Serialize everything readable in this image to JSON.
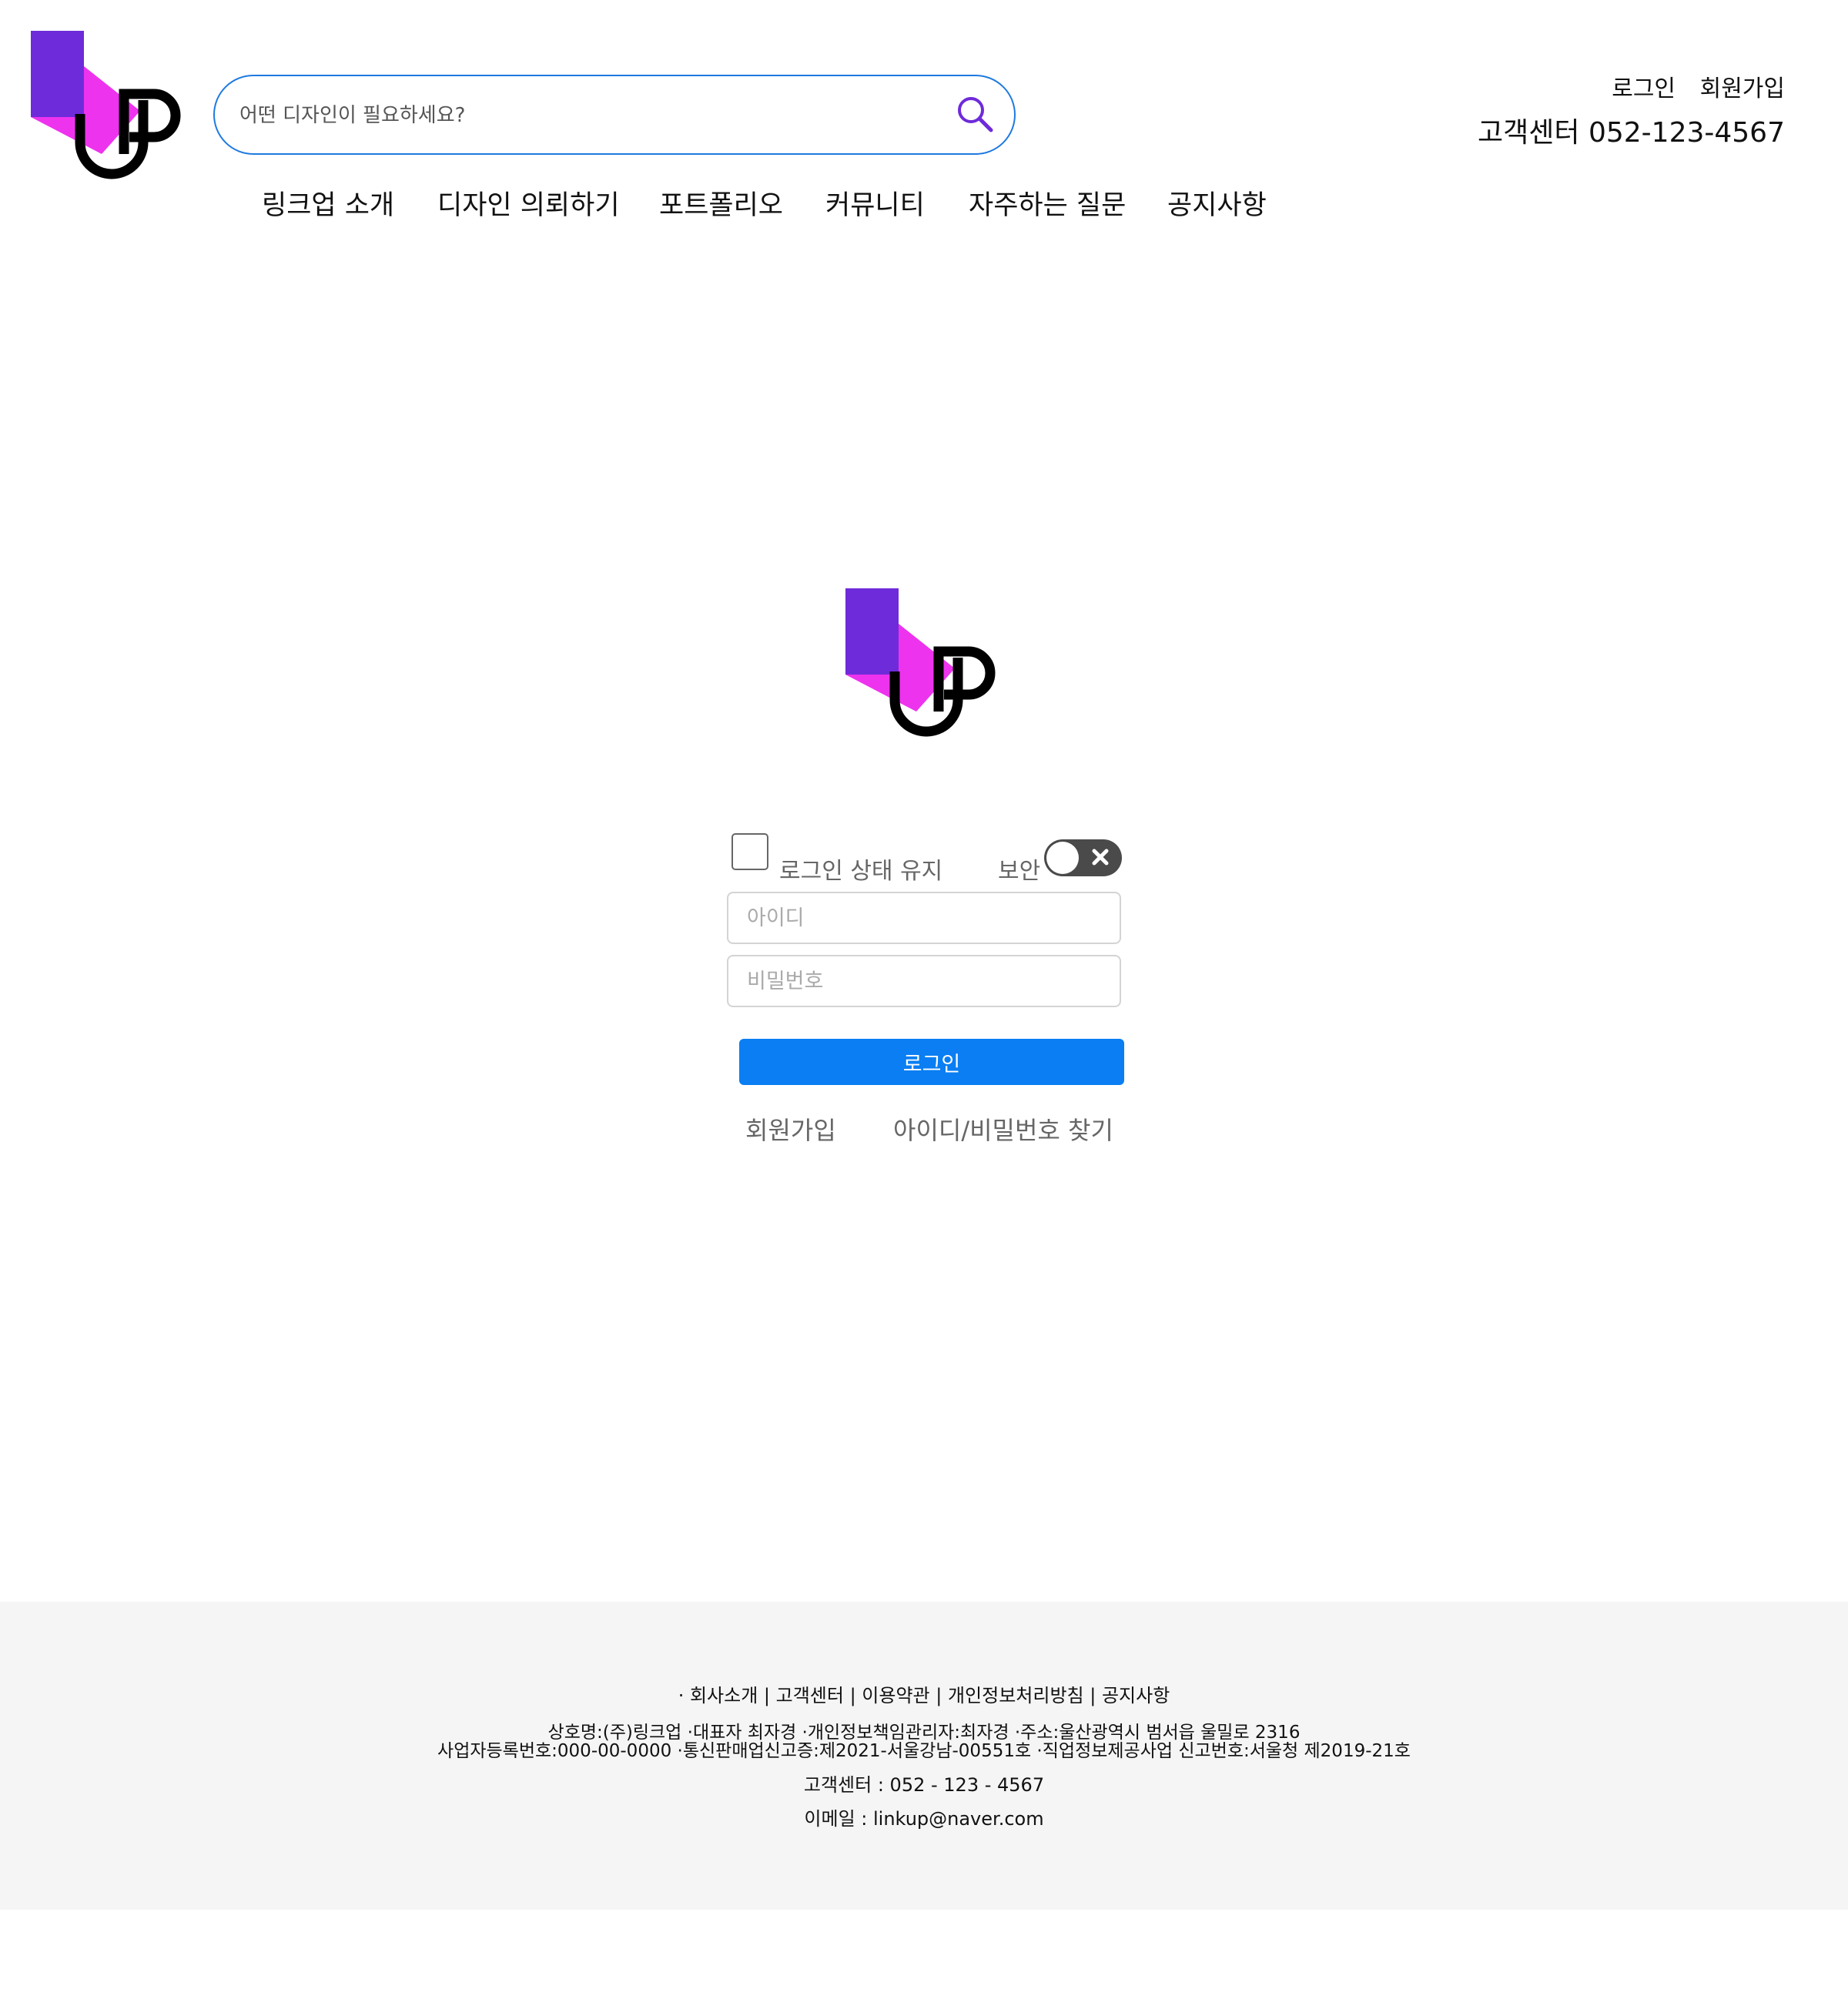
{
  "brand": {
    "logo_primary_color": "#6e2bd9",
    "logo_secondary_color": "#ee33ee",
    "logo_letter_color": "#000000"
  },
  "header": {
    "search_placeholder": "어떤 디자인이 필요하세요?",
    "search_icon": "search-icon",
    "login_link": "로그인",
    "signup_link": "회원가입",
    "customer_center": "고객센터 052-123-4567"
  },
  "nav": {
    "items": [
      {
        "label": "링크업 소개"
      },
      {
        "label": "디자인 의뢰하기"
      },
      {
        "label": "포트폴리오"
      },
      {
        "label": "커뮤니티"
      },
      {
        "label": "자주하는 질문"
      },
      {
        "label": "공지사항"
      }
    ]
  },
  "login": {
    "keep_login_label": "로그인 상태 유지",
    "keep_login_checked": false,
    "secure_label": "보안",
    "secure_toggle_on": false,
    "id_placeholder": "아이디",
    "password_placeholder": "비밀번호",
    "login_button": "로그인",
    "signup_link": "회원가입",
    "find_account_link": "아이디/비밀번호 찾기",
    "button_color": "#0a7ef2"
  },
  "footer": {
    "links": [
      "· 회사소개",
      "고객센터",
      "이용약관",
      "개인정보처리방침",
      "공지사항"
    ],
    "separator": " | ",
    "company_info_line1": "상호명:(주)링크업 ·대표자 최자경 ·개인정보책임관리자:최자경 ·주소:울산광역시 범서읍 울밀로 2316",
    "company_info_line2": "사업자등록번호:000-00-0000 ·통신판매업신고증:제2021-서울강남-00551호 ·직업정보제공사업 신고번호:서울청 제2019-21호",
    "phone": "고객센터 : 052 - 123 - 4567",
    "email": "이메일 : linkup@naver.com",
    "background": "#f5f5f5"
  }
}
